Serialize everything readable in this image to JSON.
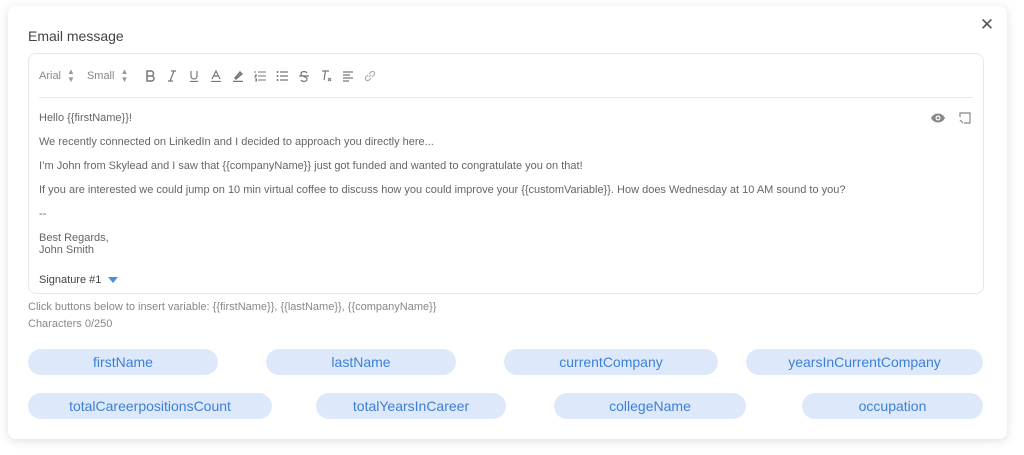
{
  "dialog": {
    "title": "Email message",
    "close_glyph": "✕"
  },
  "toolbar": {
    "font": "Arial",
    "size": "Small",
    "buttons": [
      "bold-icon",
      "italic-icon",
      "underline-icon",
      "text-color-icon",
      "highlight-icon",
      "ordered-list-icon",
      "bullet-list-icon",
      "strikethrough-icon",
      "clear-format-icon",
      "align-icon",
      "link-icon"
    ]
  },
  "message": {
    "lines": [
      "Hello {{firstName}}!",
      "We recently connected on LinkedIn and I decided to approach you directly here...",
      "I’m John from Skylead and I saw that {{companyName}} just got funded and wanted to congratulate you on that!",
      "If you are interested we could jump on 10 min virtual coffee to discuss how you could improve your {{customVariable}}. How does Wednesday at 10 AM sound to you?",
      "--",
      "Best Regards,",
      "John Smith"
    ],
    "signature": "Signature #1"
  },
  "hint": "Click buttons below to insert variable: {{firstName}}, {{lastName}}, {{companyName}}",
  "characters": "Characters 0/250",
  "variables": [
    "firstName",
    "lastName",
    "currentCompany",
    "yearsInCurrentCompany",
    "totalCareerpositionsCount",
    "totalYearsInCareer",
    "collegeName",
    "occupation"
  ],
  "colors": {
    "chip_bg": "#dde9fb",
    "chip_text": "#3d7fd6",
    "accent": "#4a90d9"
  }
}
